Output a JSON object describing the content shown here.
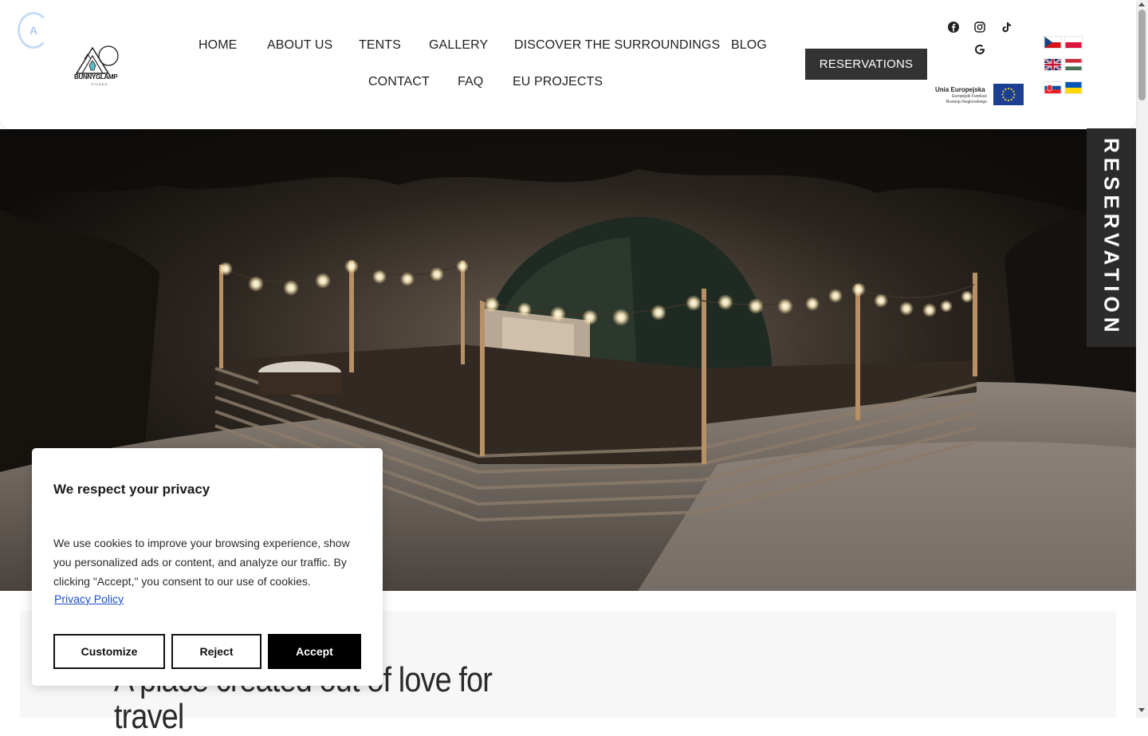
{
  "header": {
    "logo_text": "BUNNYGLAMP",
    "logo_sub": "PILSKO",
    "nav": [
      {
        "label": "HOME"
      },
      {
        "label": "ABOUT US"
      },
      {
        "label": "TENTS"
      },
      {
        "label": "GALLERY"
      },
      {
        "label": "DISCOVER THE SURROUNDINGS"
      },
      {
        "label": "BLOG"
      },
      {
        "label": "CONTACT"
      },
      {
        "label": "FAQ"
      },
      {
        "label": "EU PROJECTS"
      }
    ],
    "reservations_label": "RESERVATIONS",
    "social_icons": [
      "facebook-icon",
      "instagram-icon",
      "tiktok-icon",
      "google-icon"
    ],
    "eu": {
      "title": "Unia Europejska",
      "subtitle": "Europejski Fundusz Rozwoju Regionalnego"
    },
    "flags": [
      "flag-cz",
      "flag-pl",
      "flag-gb",
      "flag-hu",
      "flag-sk",
      "flag-ua"
    ]
  },
  "side_tab": {
    "label": "RESERVATION"
  },
  "hero": {
    "alt_icon": "glamping-dome-night-photo"
  },
  "content": {
    "headline": "A place created out of love for travel"
  },
  "cookie": {
    "title": "We respect your privacy",
    "body": "We use cookies to improve your browsing experience, show you personalized ads or content, and analyze our traffic. By clicking \"Accept,\" you consent to our use of cookies.",
    "policy_link": "Privacy Policy",
    "customize": "Customize",
    "reject": "Reject",
    "accept": "Accept"
  },
  "colors": {
    "dark_button": "#333333",
    "accept_button": "#000000",
    "link": "#1a4ec9"
  }
}
